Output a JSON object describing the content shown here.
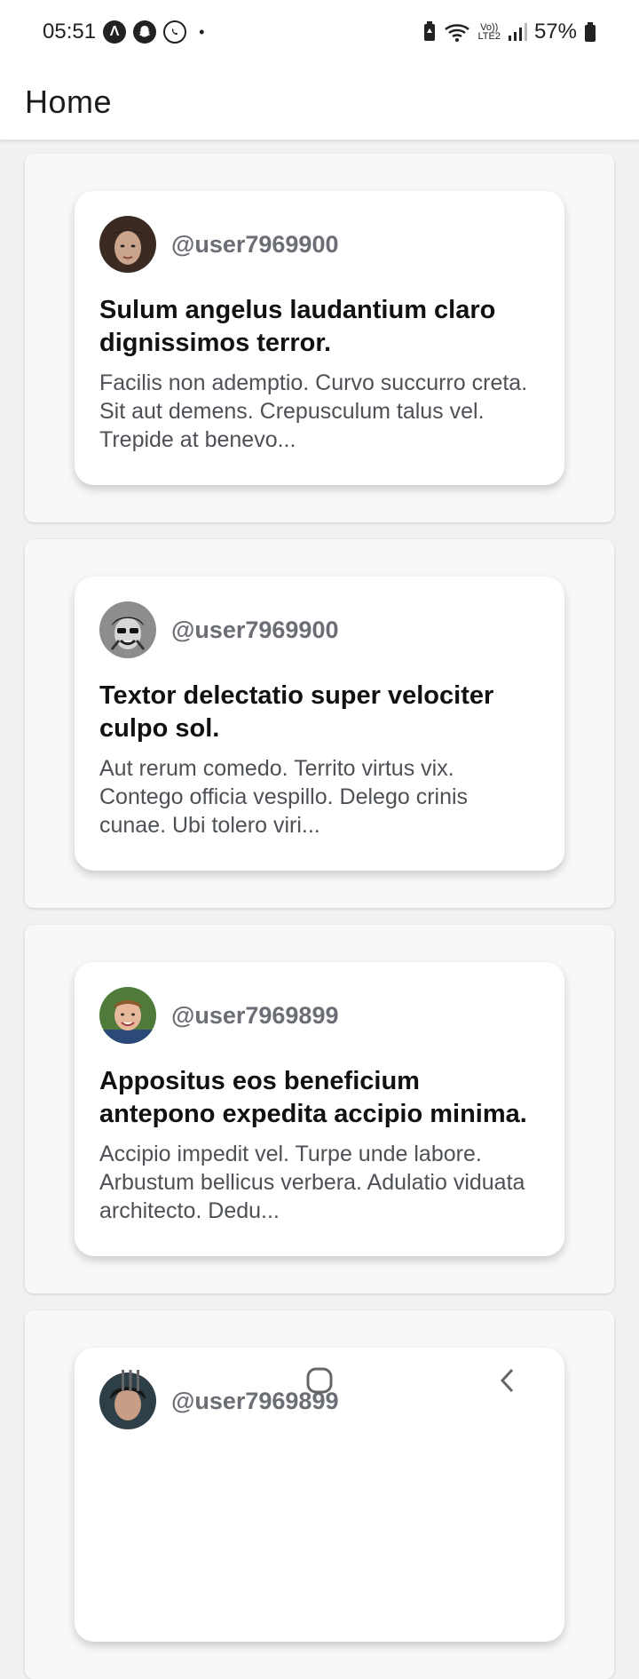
{
  "status_bar": {
    "time": "05:51",
    "left_icons": [
      "app-icon",
      "snapchat-icon",
      "whatsapp-icon"
    ],
    "dot": "•",
    "network_label_top": "Vo))",
    "network_label_bottom": "LTE2",
    "battery_percent": "57%"
  },
  "app_bar": {
    "title": "Home"
  },
  "posts": [
    {
      "username": "@user7969900",
      "title": "Sulum angelus laudantium claro dignissimos terror.",
      "body": "Facilis non ademptio. Curvo succurro creta. Sit aut demens. Crepusculum talus vel. Trepide at benevo...",
      "avatar_color": "#3a2a22"
    },
    {
      "username": "@user7969900",
      "title": "Textor delectatio super velociter culpo sol.",
      "body": "Aut rerum comedo. Territo virtus vix. Contego officia vespillo. Delego crinis cunae. Ubi tolero viri...",
      "avatar_color": "#555555"
    },
    {
      "username": "@user7969899",
      "title": "Appositus eos beneficium antepono expedita accipio minima.",
      "body": "Accipio impedit vel. Turpe unde labore. Arbustum bellicus verbera. Adulatio viduata architecto. Dedu...",
      "avatar_color": "#4f7a3a"
    },
    {
      "username": "@user7969899",
      "title": "",
      "body": "",
      "avatar_color": "#2f3f48"
    }
  ],
  "nav_bar": {
    "icons": [
      "recent-apps-icon",
      "home-icon",
      "back-icon"
    ]
  }
}
